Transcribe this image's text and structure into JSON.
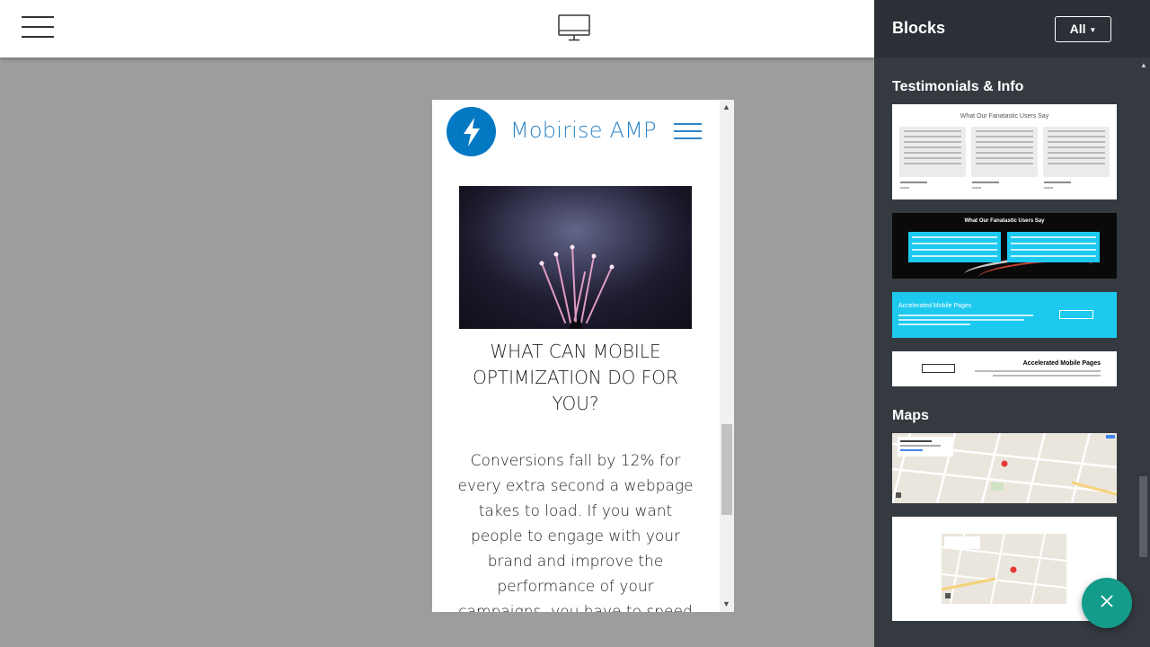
{
  "toolbar": {
    "menu_icon": "hamburger-icon",
    "device_icon": "desktop-monitor-icon"
  },
  "preview": {
    "brand": "Mobirise AMP",
    "logo_icon": "lightning-bolt-icon",
    "menu_icon": "hamburger-icon",
    "image_subject": "fireworks",
    "title": "WHAT CAN MOBILE OPTIMIZATION DO FOR YOU?",
    "body": "Conversions fall by 12% for every extra second a webpage takes to load. If you want people to engage with your brand and improve the performance of your campaigns, you have to speed"
  },
  "sidebar": {
    "title": "Blocks",
    "filter_label": "All",
    "filter_icon": "caret-down-icon",
    "sections": [
      {
        "label": "Testimonials & Info"
      },
      {
        "label": "Maps"
      }
    ]
  },
  "cards": {
    "testimonials_white_title": "What Our Fanatastic Users Say",
    "testimonials_dark_title": "What Our Fanatastic Users Say",
    "amp_cyan_title": "Accelerated Mobile Pages",
    "amp_white_title": "Accelerated Mobile Pages"
  },
  "fab_icon": "close-icon",
  "colors": {
    "accent_blue": "#2e84c6",
    "amp_logo": "#0379c4",
    "sidebar_bg": "#343a40",
    "fab": "#149c8b",
    "cyan_block": "#1dc9ef"
  }
}
